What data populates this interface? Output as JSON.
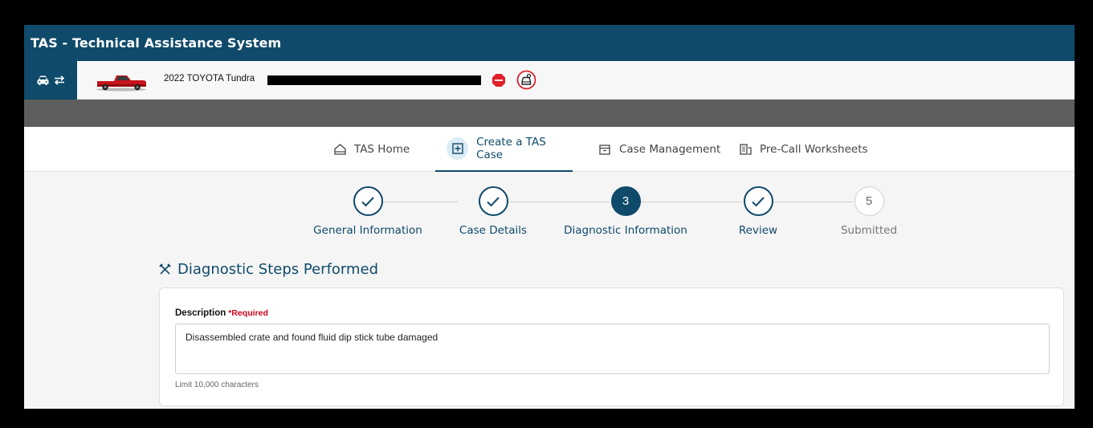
{
  "app": {
    "title": "TAS - Technical Assistance System"
  },
  "vehicle": {
    "name": "2022 TOYOTA Tundra"
  },
  "nav": [
    {
      "label": "TAS Home",
      "icon": "home-icon"
    },
    {
      "label": "Create a TAS Case",
      "icon": "plus-square-icon",
      "active": true
    },
    {
      "label": "Case Management",
      "icon": "archive-icon"
    },
    {
      "label": "Pre-Call Worksheets",
      "icon": "worksheet-icon"
    }
  ],
  "steps": [
    {
      "label": "General Information",
      "state": "done"
    },
    {
      "label": "Case Details",
      "state": "done"
    },
    {
      "label": "Diagnostic Information",
      "state": "current",
      "number": "3"
    },
    {
      "label": "Review",
      "state": "done"
    },
    {
      "label": "Submitted",
      "state": "pending",
      "number": "5"
    }
  ],
  "section": {
    "title": "Diagnostic Steps Performed"
  },
  "form": {
    "description_label": "Description",
    "required_label": "*Required",
    "description_value": "Disassembled crate and found fluid dip stick tube damaged",
    "limit_text": "Limit 10,000 characters"
  },
  "colors": {
    "brand": "#0f4a6a",
    "required": "#d0021b",
    "stop": "#e0202a"
  }
}
